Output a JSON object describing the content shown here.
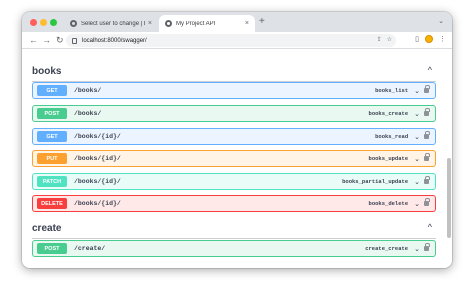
{
  "browser": {
    "tabs": [
      {
        "title": "Select user to change | Djang",
        "close": "×"
      },
      {
        "title": "My Project API",
        "close": "×"
      }
    ],
    "new_tab": "+",
    "tab_search": "⌄",
    "nav": {
      "back": "←",
      "forward": "→",
      "reload": "↻"
    },
    "url": "localhost:8000/swagger/",
    "omnibox_icons": {
      "share": "⇪",
      "bookmark": "☆"
    },
    "toolbar_icons": {
      "sidebar": "▯",
      "menu": "⋮"
    }
  },
  "swagger": {
    "sections": [
      {
        "title": "books",
        "toggle": "^",
        "operations": [
          {
            "method": "GET",
            "path": "/books/",
            "operation_id": "books_list",
            "color": "#61affe"
          },
          {
            "method": "POST",
            "path": "/books/",
            "operation_id": "books_create",
            "color": "#49cc90"
          },
          {
            "method": "GET",
            "path": "/books/{id}/",
            "operation_id": "books_read",
            "color": "#61affe"
          },
          {
            "method": "PUT",
            "path": "/books/{id}/",
            "operation_id": "books_update",
            "color": "#fca130"
          },
          {
            "method": "PATCH",
            "path": "/books/{id}/",
            "operation_id": "books_partial_update",
            "color": "#50e3c2"
          },
          {
            "method": "DELETE",
            "path": "/books/{id}/",
            "operation_id": "books_delete",
            "color": "#f93e3e"
          }
        ]
      },
      {
        "title": "create",
        "toggle": "^",
        "operations": [
          {
            "method": "POST",
            "path": "/create/",
            "operation_id": "create_create",
            "color": "#49cc90"
          }
        ]
      }
    ],
    "chevron": "⌄"
  }
}
